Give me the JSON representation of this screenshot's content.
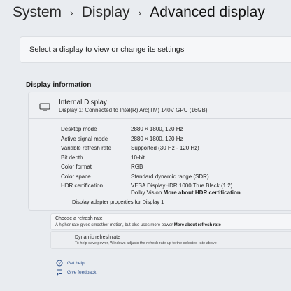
{
  "breadcrumb": {
    "items": [
      "System",
      "Display",
      "Advanced display"
    ],
    "separator": "›"
  },
  "selector": {
    "prompt": "Select a display to view or change its settings"
  },
  "display_info": {
    "section_title": "Display information",
    "name": "Internal Display",
    "subtitle": "Display 1: Connected to Intel(R) Arc(TM) 140V GPU (16GB)",
    "icon": "monitor-icon",
    "properties": [
      {
        "label": "Desktop mode",
        "value": "2880 × 1800, 120 Hz"
      },
      {
        "label": "Active signal mode",
        "value": "2880 × 1800, 120 Hz"
      },
      {
        "label": "Variable refresh rate",
        "value": "Supported (30 Hz - 120 Hz)"
      },
      {
        "label": "Bit depth",
        "value": "10-bit"
      },
      {
        "label": "Color format",
        "value": "RGB"
      },
      {
        "label": "Color space",
        "value": "Standard dynamic range (SDR)"
      }
    ],
    "hdr": {
      "label": "HDR certification",
      "line1": "VESA DisplayHDR 1000 True Black (1.2)",
      "line2_prefix": "Dolby Vision",
      "line2_link": "More about HDR certification"
    },
    "adapter_link": "Display adapter properties for Display 1"
  },
  "refresh_rate": {
    "title": "Choose a refresh rate",
    "description": "A higher rate gives smoother motion, but also uses more power",
    "link": "More about refresh rate"
  },
  "dynamic_refresh": {
    "title": "Dynamic refresh rate",
    "description": "To help save power, Windows adjusts the refresh rate up to the selected rate above"
  },
  "footer": {
    "get_help": "Get help",
    "give_feedback": "Give feedback"
  },
  "colors": {
    "background": "#e9ecf0",
    "card": "#eef0f3",
    "link": "#2c4f8a"
  }
}
